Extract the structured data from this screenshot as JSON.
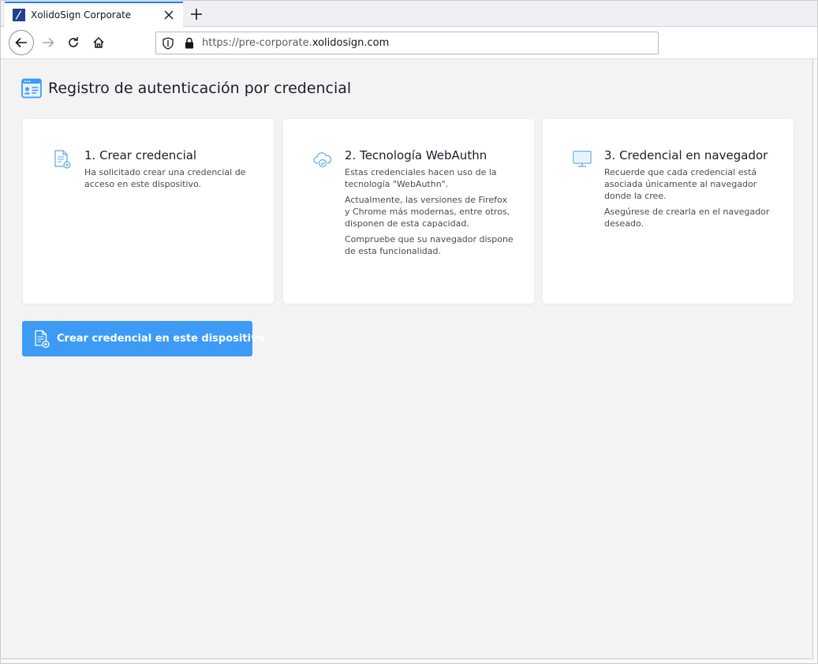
{
  "browser": {
    "tab_title": "XolidoSign Corporate",
    "url_prefix": "https://pre-corporate.",
    "url_domain": "xolidosign.com"
  },
  "page": {
    "title": "Registro de autenticación por credencial"
  },
  "cards": [
    {
      "title": "1. Crear credencial",
      "paragraphs": [
        "Ha solicitado crear una credencial de acceso en este dispositivo."
      ],
      "icon": "document-add-icon"
    },
    {
      "title": "2. Tecnología WebAuthn",
      "paragraphs": [
        "Estas credenciales hacen uso de la tecnología \"WebAuthn\".",
        "Actualmente, las versiones de Firefox y Chrome más modernas, entre otros, disponen de esta capacidad.",
        "Compruebe que su navegador dispone de esta funcionalidad."
      ],
      "icon": "cloud-check-icon"
    },
    {
      "title": "3. Credencial en navegador",
      "paragraphs": [
        "Recuerde que cada credencial está asociada únicamente al navegador donde la cree.",
        "Asegúrese de crearla en el navegador deseado."
      ],
      "icon": "monitor-icon"
    }
  ],
  "actions": {
    "create_label": "Crear credencial en este dispositivo"
  },
  "colors": {
    "accent": "#3d9bf5",
    "icon_blue": "#5aa7f0",
    "page_bg": "#f3f3f4"
  }
}
